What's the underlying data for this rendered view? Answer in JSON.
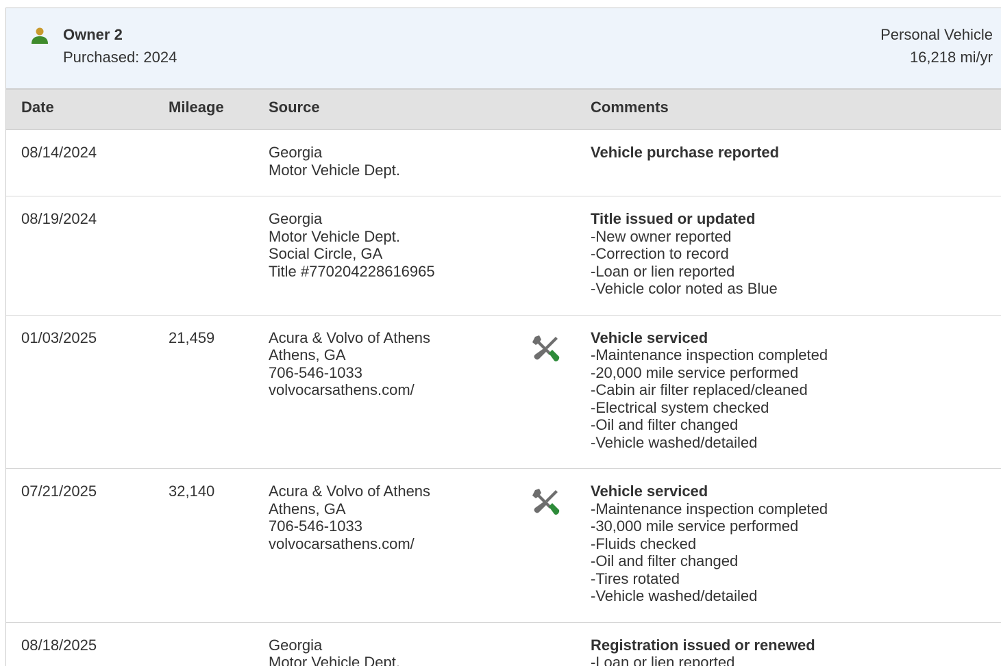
{
  "owner": {
    "name": "Owner 2",
    "purchased": "Purchased: 2024",
    "usage": "Personal Vehicle",
    "miles_per_year": "16,218 mi/yr",
    "icon": "person-icon"
  },
  "table": {
    "headers": {
      "date": "Date",
      "mileage": "Mileage",
      "source": "Source",
      "comments": "Comments"
    },
    "rows": [
      {
        "date": "08/14/2024",
        "mileage": "",
        "source": [
          "Georgia",
          "Motor Vehicle Dept."
        ],
        "icon": "",
        "comment_title": "Vehicle purchase reported",
        "comment_items": []
      },
      {
        "date": "08/19/2024",
        "mileage": "",
        "source": [
          "Georgia",
          "Motor Vehicle Dept.",
          "Social Circle, GA",
          "Title #770204228616965"
        ],
        "icon": "",
        "comment_title": "Title issued or updated",
        "comment_items": [
          "New owner reported",
          "Correction to record",
          "Loan or lien reported",
          "Vehicle color noted as Blue"
        ]
      },
      {
        "date": "01/03/2025",
        "mileage": "21,459",
        "source": [
          "Acura & Volvo of Athens",
          "Athens, GA",
          "706-546-1033",
          "volvocarsathens.com/"
        ],
        "icon": "service-tools-icon",
        "comment_title": "Vehicle serviced",
        "comment_items": [
          "Maintenance inspection completed",
          "20,000 mile service performed",
          "Cabin air filter replaced/cleaned",
          "Electrical system checked",
          "Oil and filter changed",
          "Vehicle washed/detailed"
        ]
      },
      {
        "date": "07/21/2025",
        "mileage": "32,140",
        "source": [
          "Acura & Volvo of Athens",
          "Athens, GA",
          "706-546-1033",
          "volvocarsathens.com/"
        ],
        "icon": "service-tools-icon",
        "comment_title": "Vehicle serviced",
        "comment_items": [
          "Maintenance inspection completed",
          "30,000 mile service performed",
          "Fluids checked",
          "Oil and filter changed",
          "Tires rotated",
          "Vehicle washed/detailed"
        ]
      },
      {
        "date": "08/18/2025",
        "mileage": "",
        "source": [
          "Georgia",
          "Motor Vehicle Dept."
        ],
        "icon": "",
        "comment_title": "Registration issued or renewed",
        "comment_items": [
          "Loan or lien reported"
        ]
      }
    ]
  },
  "colors": {
    "header_bg": "#eef4fb",
    "table_head_bg": "#e2e2e2",
    "icon_green": "#2e8b3a",
    "icon_person": "#5a8f1e",
    "icon_gray": "#6e6e6e"
  }
}
